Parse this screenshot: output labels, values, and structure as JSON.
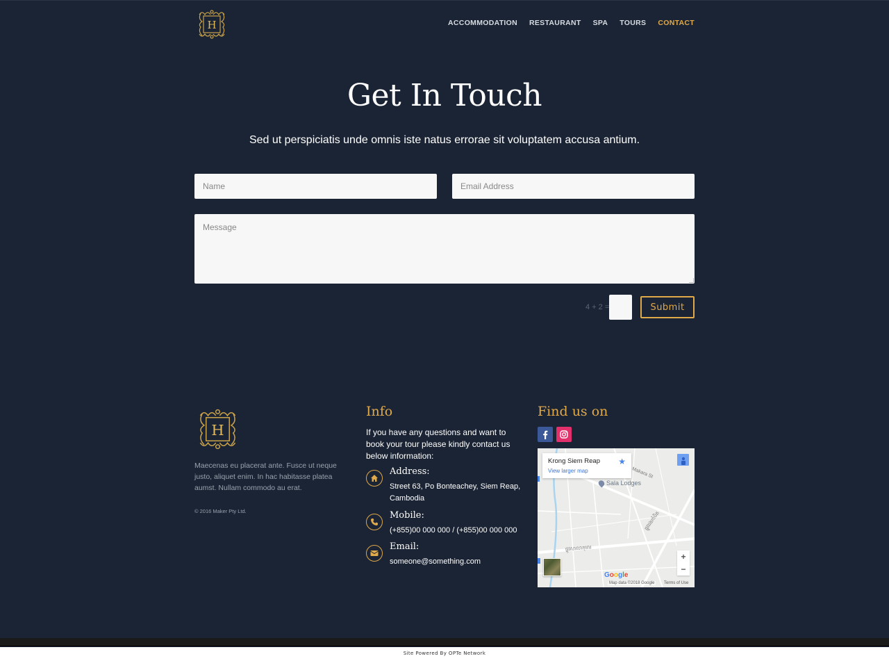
{
  "colors": {
    "background": "#1b2434",
    "accent": "#e0a94a",
    "input_bg": "#f7f7f7",
    "facebook": "#3b5998",
    "instagram": "#e1306c"
  },
  "header": {
    "logo_letter": "H",
    "logo_icon": "ornate-monogram-logo",
    "nav": [
      {
        "label": "ACCOMMODATION",
        "active": false
      },
      {
        "label": "RESTAURANT",
        "active": false
      },
      {
        "label": "SPA",
        "active": false
      },
      {
        "label": "TOURS",
        "active": false
      },
      {
        "label": "CONTACT",
        "active": true
      }
    ]
  },
  "hero": {
    "title": "Get In Touch",
    "subtitle": "Sed ut perspiciatis unde omnis iste natus errorae sit voluptatem accusa antium."
  },
  "form": {
    "name_placeholder": "Name",
    "name_value": "",
    "email_placeholder": "Email Address",
    "email_value": "",
    "message_placeholder": "Message",
    "message_value": "",
    "captcha_label": "4 + 2 =",
    "captcha_value": "",
    "submit_label": "Submit"
  },
  "footer": {
    "logo_letter": "H",
    "about": "Maecenas eu placerat ante. Fusce ut neque justo, aliquet enim. In hac habitasse platea aumst. Nullam commodo au erat.",
    "copyright": "© 2016 Maker Pty Ltd.",
    "info": {
      "title": "Info",
      "intro": "If you have any questions and want to book your tour please kindly contact us below information:",
      "items": [
        {
          "icon": "home-icon",
          "label": "Address:",
          "value": "Street 63, Po Bonteachey, Siem Reap, Cambodia"
        },
        {
          "icon": "phone-icon",
          "label": "Mobile:",
          "value": "(+855)00 000 000 / (+855)00 000 000"
        },
        {
          "icon": "envelope-icon",
          "label": "Email:",
          "value": "someone@something.com"
        }
      ]
    },
    "find_us": {
      "title": "Find us on",
      "social": [
        {
          "name": "facebook",
          "glyph": "f"
        },
        {
          "name": "instagram",
          "glyph": "◎"
        }
      ],
      "map": {
        "place_name": "Krong Siem Reap",
        "view_larger": "View larger map",
        "poi": "Sala Lodges",
        "street_1": "Makara St",
        "street_2": "ផ្លូវសាលាកុមារ",
        "street_3": "ផ្លូវដងកាំបិត",
        "zoom_in": "+",
        "zoom_out": "−",
        "brand": "Google",
        "attribution": "Map data ©2018 Google",
        "terms": "Terms of Use"
      }
    }
  },
  "bottom": {
    "powered_by": "Site Powered By OPTe Network"
  }
}
